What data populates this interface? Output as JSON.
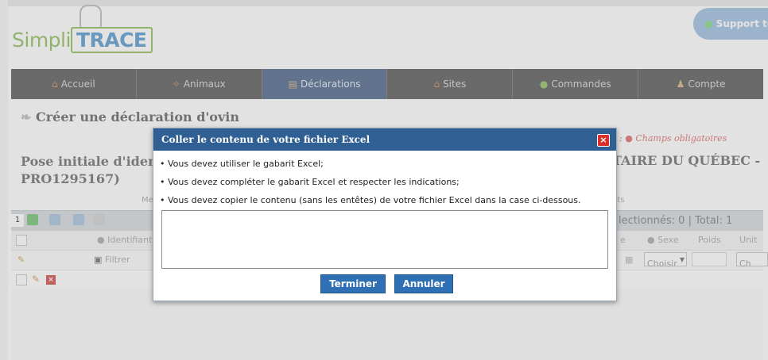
{
  "header": {
    "logo_left": "Simpli",
    "logo_right": "TRACE",
    "support_label": "Support te"
  },
  "nav": {
    "items": [
      {
        "label": "Accueil",
        "icon": "home-icon"
      },
      {
        "label": "Animaux",
        "icon": "animals-icon"
      },
      {
        "label": "Déclarations",
        "icon": "document-icon"
      },
      {
        "label": "Sites",
        "icon": "site-icon"
      },
      {
        "label": "Commandes",
        "icon": "order-icon"
      },
      {
        "label": "Compte",
        "icon": "user-icon"
      }
    ],
    "active_index": 2
  },
  "page": {
    "title": "Créer une déclaration d'ovin",
    "legend_prefix": "de : ",
    "legend_required": "● Champs obligatoires",
    "section_title_left": "Pose initiale d'identi",
    "section_title_left_2": "PRO1295167)",
    "section_title_right": "TAIRE DU QUÉBEC -",
    "hint_left": "Mes",
    "hint_right": "nts"
  },
  "grid": {
    "page_number": "1",
    "selection_summary": "lectionnés: 0 | Total: 1",
    "headers": [
      "● Identifiants",
      "e",
      "● Sexe",
      "Poids",
      "Unit"
    ],
    "filter_placeholder": "Filtrer",
    "sex_select": "Choisir",
    "unit_select": "Ch"
  },
  "dialog": {
    "title": "Coller le contenu de votre fichier Excel",
    "instructions": [
      "• Vous devez utiliser le gabarit Excel;",
      "• Vous devez compléter le gabarit Excel et respecter les indications;",
      "• Vous devez copier le contenu (sans les entêtes) de votre fichier Excel dans la case ci-dessous."
    ],
    "paste_value": "",
    "finish_label": "Terminer",
    "cancel_label": "Annuler"
  }
}
